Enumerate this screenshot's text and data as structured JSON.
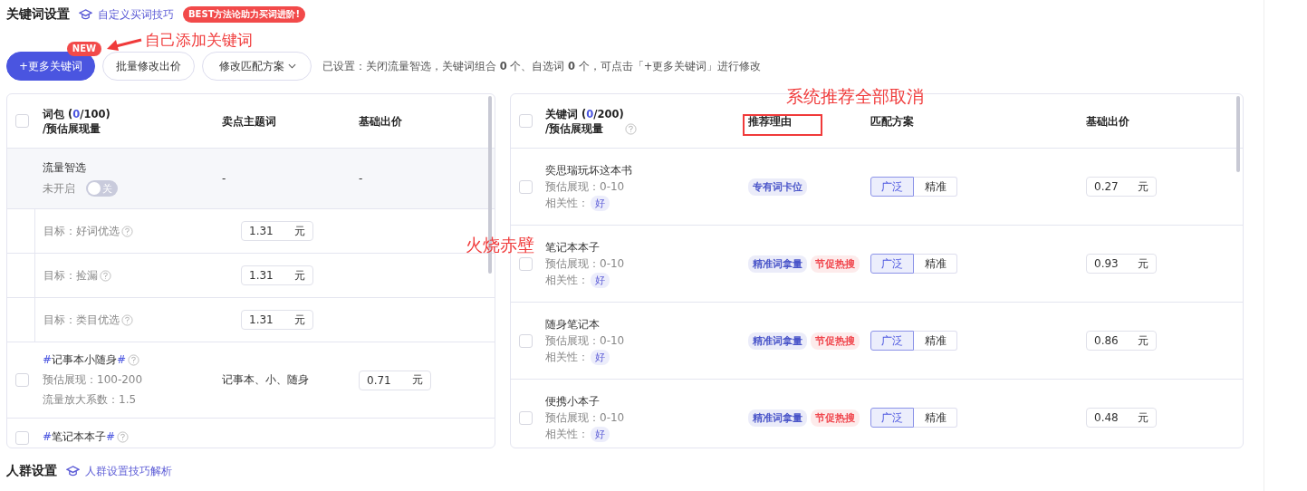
{
  "header": {
    "title": "关键词设置",
    "link": "自定义买词技巧",
    "badge": "BEST方法论助力买词进阶!"
  },
  "toolbar": {
    "buttons": [
      {
        "label": "+更多关键词",
        "kind": "primary",
        "badge": "NEW"
      },
      {
        "label": "批量修改出价",
        "kind": "plain"
      },
      {
        "label": "修改匹配方案",
        "kind": "dropdown"
      }
    ],
    "summary": "已设置：关闭流量智选，关键词组合 **0** 个、自选词 **0** 个，可点击「+更多关键词」进行修改"
  },
  "left_table": {
    "head": {
      "checked": false,
      "label": "词包 (",
      "count": "0",
      "total": "/100)",
      "sub": "/预估展现量"
    },
    "columns": [
      "卖点主题词",
      "基础出价"
    ],
    "rows": [
      {
        "kind": "smart",
        "name": "流量智选",
        "status": "未开启",
        "switch": {
          "on": false,
          "label": "关"
        },
        "theme": "-",
        "price": "-"
      },
      {
        "kind": "goal",
        "label": "目标：好词优选",
        "price": "1.31",
        "unit": "元"
      },
      {
        "kind": "goal",
        "label": "目标：捡漏",
        "price": "1.31",
        "unit": "元"
      },
      {
        "kind": "goal",
        "label": "目标：类目优选",
        "price": "1.31",
        "unit": "元"
      },
      {
        "kind": "keyword",
        "checked": false,
        "prefix": "#",
        "name": "记事本小随身",
        "suffix": "#",
        "impressions": "预估展现：100-200",
        "factor": "流量放大系数：1.5",
        "theme": "记事本、小、随身",
        "price": "0.71",
        "unit": "元"
      },
      {
        "kind": "keyword_cut",
        "checked": false,
        "prefix": "#",
        "name": "笔记本本子",
        "suffix": "#"
      }
    ]
  },
  "right_table": {
    "head": {
      "checked": false,
      "label": "关键词 (",
      "count": "0",
      "total": "/200)",
      "sub": "/预估展现量"
    },
    "columns": [
      "推荐理由",
      "匹配方案",
      "基础出价"
    ],
    "rows": [
      {
        "checked": false,
        "name": "奕思瑞玩坏这本书",
        "impressions": "预估展现：0-10",
        "relevance_label": "相关性：",
        "relevance": "好",
        "reasons": [
          {
            "text": "专有词卡位",
            "color": "#4a55c9"
          }
        ],
        "match": [
          {
            "label": "广泛",
            "selected": true
          },
          {
            "label": "精准",
            "selected": false
          }
        ],
        "price": "0.27",
        "unit": "元"
      },
      {
        "checked": false,
        "name": "笔记本本子",
        "impressions": "预估展现：0-10",
        "relevance_label": "相关性：",
        "relevance": "好",
        "reasons": [
          {
            "text": "精准词拿量",
            "color": "#4a55c9"
          },
          {
            "text": "节促热搜",
            "color": "#f0454c"
          }
        ],
        "match": [
          {
            "label": "广泛",
            "selected": true
          },
          {
            "label": "精准",
            "selected": false
          }
        ],
        "price": "0.93",
        "unit": "元"
      },
      {
        "checked": false,
        "name": "随身笔记本",
        "impressions": "预估展现：0-10",
        "relevance_label": "相关性：",
        "relevance": "好",
        "reasons": [
          {
            "text": "精准词拿量",
            "color": "#4a55c9"
          },
          {
            "text": "节促热搜",
            "color": "#f0454c"
          }
        ],
        "match": [
          {
            "label": "广泛",
            "selected": true
          },
          {
            "label": "精准",
            "selected": false
          }
        ],
        "price": "0.86",
        "unit": "元"
      },
      {
        "checked": false,
        "name": "便携小本子",
        "impressions": "预估展现：0-10",
        "relevance_label": "相关性：",
        "relevance": "好",
        "reasons": [
          {
            "text": "精准词拿量",
            "color": "#4a55c9"
          },
          {
            "text": "节促热搜",
            "color": "#f0454c"
          }
        ],
        "match": [
          {
            "label": "广泛",
            "selected": true
          },
          {
            "label": "精准",
            "selected": false
          }
        ],
        "price": "0.48",
        "unit": "元"
      }
    ]
  },
  "footer": {
    "title": "人群设置",
    "link": "人群设置技巧解析"
  },
  "annotations": [
    "自己添加关键词",
    "系统推荐全部取消",
    "火烧赤壁"
  ]
}
